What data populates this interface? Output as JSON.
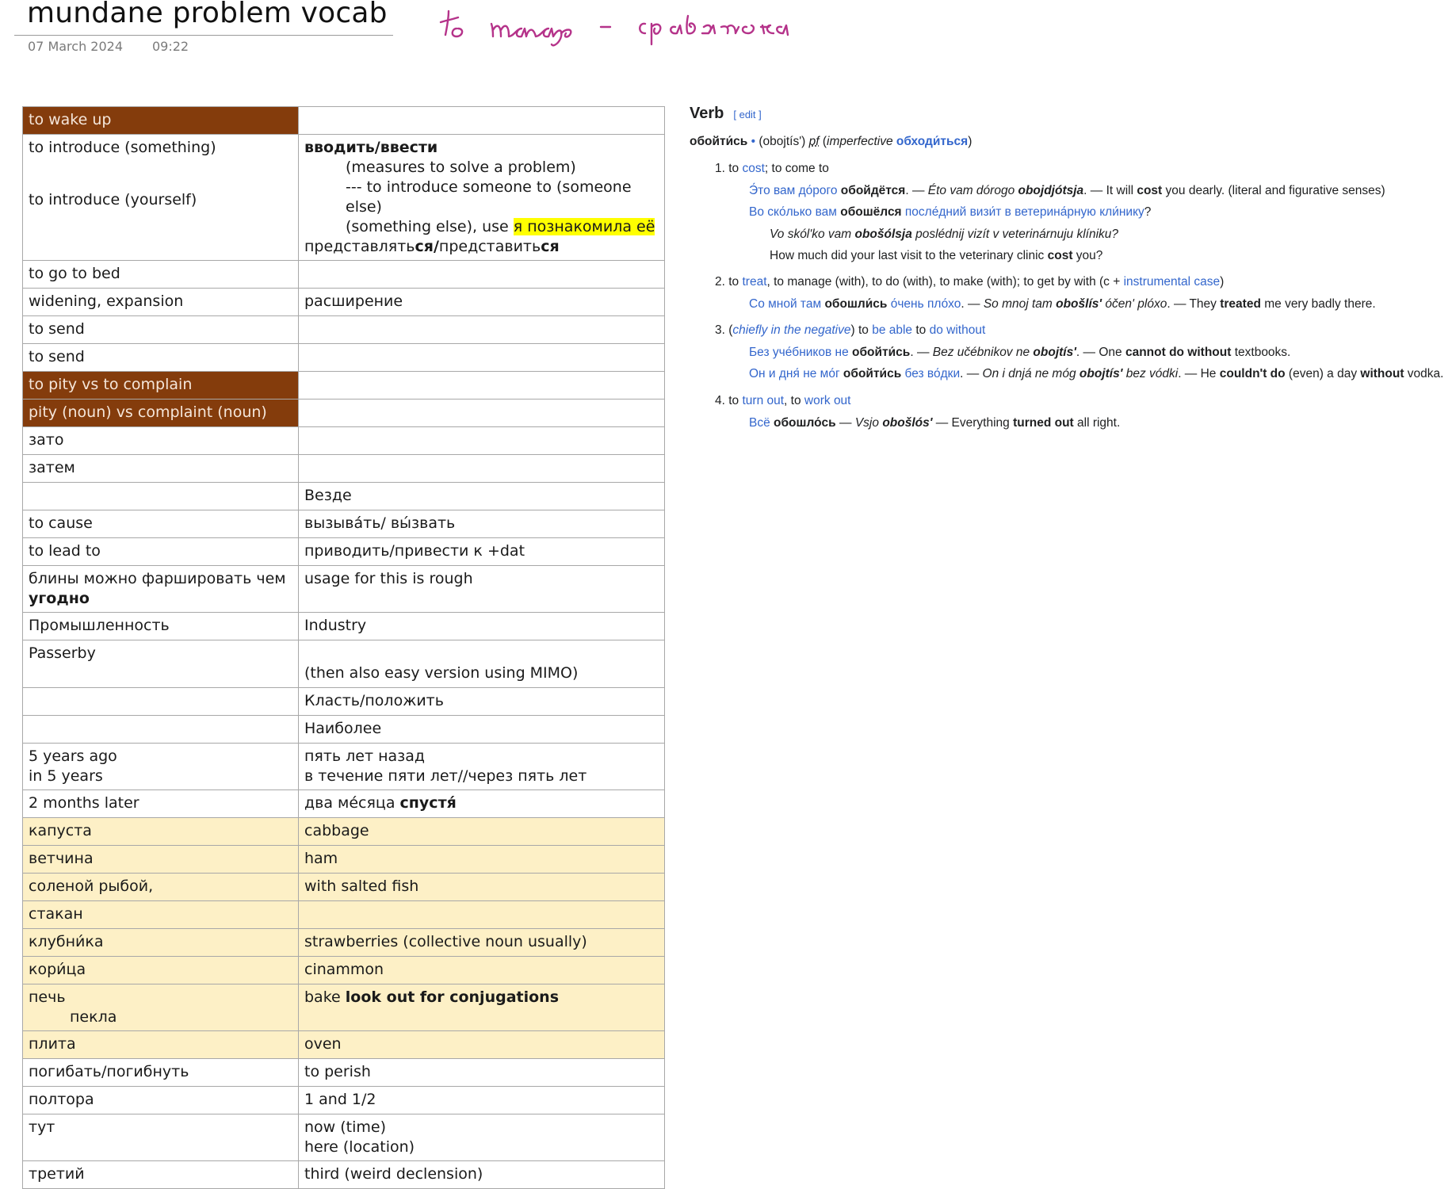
{
  "note": {
    "title": "mundane problem vocab",
    "date": "07 March 2024",
    "time": "09:22",
    "handwritten": "to manage - справляется",
    "ink_color": "#b5338a"
  },
  "table": {
    "rows": [
      {
        "left": "to wake up",
        "right": "",
        "style": "brown"
      },
      {
        "left_a": "to introduce (something)",
        "left_b": "to introduce (yourself)",
        "right_head": "вводить/ввести",
        "right_1": "(measures to solve a problem)",
        "right_2": "--- to introduce someone to (someone else)",
        "right_3_pre": "(something else), use ",
        "right_3_hl": "я познакомила её",
        "right_4_a": "представлять",
        "right_4_b": "ся/",
        "right_4_c": "представить",
        "right_4_d": "ся"
      },
      {
        "left": "to go to bed",
        "right": ""
      },
      {
        "left": "widening, expansion",
        "right": "расширение"
      },
      {
        "left": "to send",
        "right": ""
      },
      {
        "left": "to send",
        "right": ""
      },
      {
        "left": "to pity vs to complain",
        "right": "",
        "style": "brown"
      },
      {
        "left": "pity (noun) vs complaint (noun)",
        "right": "",
        "style": "brown"
      },
      {
        "left": "зато",
        "right": ""
      },
      {
        "left": "затем",
        "right": ""
      },
      {
        "left": "",
        "right": "Везде"
      },
      {
        "left": "to cause",
        "right": "вызыва́ть/ вы́звать"
      },
      {
        "left": "to lead to",
        "right": "приводить/привести к +dat"
      },
      {
        "left_a": "блины можно фаршировать чем",
        "left_b": "угодно",
        "right": "usage for this is rough"
      },
      {
        "left": "Промышленность",
        "right": "Industry"
      },
      {
        "left": "Passerby",
        "right": "(then also easy version using MIMO)"
      },
      {
        "left": "",
        "right": "Класть/положить"
      },
      {
        "left": "",
        "right": "Наиболее"
      },
      {
        "left_a": "5 years ago",
        "left_b": "in 5 years",
        "right_a": "пять лет назад",
        "right_b": "в течение пяти лет//через пять лет"
      },
      {
        "left": "2 months later",
        "right_a": "два ме́сяца ",
        "right_b": "спустя́"
      },
      {
        "left": "капуста",
        "right": "cabbage",
        "style": "cream"
      },
      {
        "left": "ветчина",
        "right": "ham",
        "style": "cream"
      },
      {
        "left": "соленой рыбой,",
        "right": "with salted fish",
        "style": "cream"
      },
      {
        "left": "стакан",
        "right": "",
        "style": "cream"
      },
      {
        "left": "клубни́ка",
        "right": "strawberries (collective noun usually)",
        "style": "cream"
      },
      {
        "left": "кори́ца",
        "right": "cinammon",
        "style": "cream"
      },
      {
        "left_a": "печь",
        "left_b": "пекла",
        "right_a": "bake ",
        "right_b": "look out for conjugations",
        "style": "cream"
      },
      {
        "left": "плита",
        "right": "oven",
        "style": "cream"
      },
      {
        "left": "погибать/погибнуть",
        "right": "to perish"
      },
      {
        "left": "полтора",
        "right": "1 and 1/2"
      },
      {
        "left": "тут",
        "right_a": "now (time)",
        "right_b": "here (location)"
      },
      {
        "left": "третий",
        "right": "third (weird declension)"
      }
    ]
  },
  "wiki": {
    "heading": "Verb",
    "edit": "[ edit ]",
    "headword": "обойти́сь",
    "bullet": " • ",
    "translit": "(obojtísʹ) ",
    "aspect": "pf",
    "imperf_label": "imperfective ",
    "imperf_word": "обходи́ться",
    "senses": [
      {
        "num": "1.",
        "text_a": "to ",
        "link_a": "cost",
        "text_b": "; to come to"
      },
      {
        "num": "2.",
        "text_a": "to ",
        "link_a": "treat",
        "text_b": ", to manage (with), to do (with), to make (with); to get by with (с + ",
        "link_b": "instrumental case",
        "text_c": ")"
      },
      {
        "num": "3.",
        "text_a": "(",
        "link_a": "chiefly in the negative",
        "text_b": ") to ",
        "link_b": "be able",
        "text_c": " to ",
        "link_c": "do without"
      },
      {
        "num": "4.",
        "text_a": "to ",
        "link_a": "turn out",
        "text_b": ", to ",
        "link_b": "work out"
      }
    ],
    "examples": {
      "e1": {
        "ru": "Э́то вам до́рого ",
        "ru_b": "обойдётся",
        "dash1": ". — ",
        "tr": "Éto vam dórogo ",
        "tr_b": "obojdjótsja",
        "dash2": ". — It will ",
        "en_b": "cost",
        "en": " you dearly. (literal and figurative senses)"
      },
      "e2": {
        "ru": "Во ско́лько вам ",
        "ru_b": "обошёлся",
        "ru_c": " после́дний визи́т в ветерина́рную кли́нику",
        "q": "?"
      },
      "e2_tr": {
        "a": "Vo skólʹko vam ",
        "b": "obošólsja",
        "c": " poslédnij vizít v veterinárnuju klíniku?"
      },
      "e2_en": {
        "a": "How much did your last visit to the veterinary clinic ",
        "b": "cost",
        "c": " you?"
      },
      "e3": {
        "ru": "Со мной там ",
        "ru_b": "обошли́сь",
        "ru_c": " о́чень пло́хо",
        "dash1": ". — ",
        "tr": "So mnoj tam ",
        "tr_b": "obošlísʹ",
        "tr_c": " óčenʹ plóxo",
        "dash2": ". — They ",
        "en_b": "treated",
        "en": " me very badly there."
      },
      "e4": {
        "ru": "Без уче́бников не ",
        "ru_b": "обойти́сь",
        "dash1": ". — ",
        "tr": "Bez učébnikov ne ",
        "tr_b": "obojtísʹ",
        "dash2": ". — One ",
        "en_b": "cannot do without",
        "en": " textbooks."
      },
      "e5": {
        "ru": "Он и дня́ не мо́г ",
        "ru_b": "обойти́сь",
        "ru_c": " без во́дки",
        "dash1": ". — ",
        "tr": "On i dnjá ne móg ",
        "tr_b": "obojtísʹ",
        "tr_c": " bez vódki",
        "dash2": ". — He ",
        "en_b": "couldn't do",
        "en_c": " (even) a day ",
        "en_d": "without",
        "en": " vodka."
      },
      "e6": {
        "ru": "Всё ",
        "ru_b": "обошло́сь",
        "dash1": " — ",
        "tr": "Vsjo ",
        "tr_b": "obošlósʹ",
        "dash2": " — Everything ",
        "en_b": "turned out",
        "en": " all right."
      }
    },
    "link_color": "#3366cc"
  }
}
